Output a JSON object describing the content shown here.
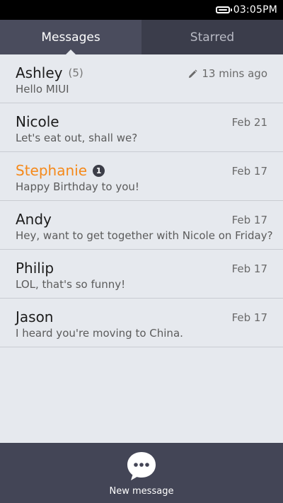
{
  "status_bar": {
    "time": "03:05PM",
    "battery_icon": "battery-full-icon"
  },
  "tabs": [
    {
      "label": "Messages",
      "active": true
    },
    {
      "label": "Starred",
      "active": false
    }
  ],
  "conversations": [
    {
      "name": "Ashley",
      "count": "(5)",
      "time": "13 mins ago",
      "draft_icon": "pencil-icon",
      "preview": "Hello MIUI"
    },
    {
      "name": "Nicole",
      "time": "Feb 21",
      "preview": "Let's eat out, shall we?"
    },
    {
      "name": "Stephanie",
      "unread": "1",
      "time": "Feb 17",
      "preview": "Happy Birthday to you!",
      "highlight_color": "#f5891a"
    },
    {
      "name": "Andy",
      "time": "Feb 17",
      "preview": "Hey, want to get together with Nicole on Friday?"
    },
    {
      "name": "Philip",
      "time": "Feb 17",
      "preview": "LOL, that's so funny!"
    },
    {
      "name": "Jason",
      "time": "Feb 17",
      "preview": "I heard you're moving to China."
    }
  ],
  "bottom_bar": {
    "label": "New message",
    "icon": "speech-bubble-icon"
  },
  "colors": {
    "tab_bar": "#3b3d4b",
    "active_tab": "#4a4c5d",
    "list_background": "#e6e9ee",
    "bottom_bar": "#434556",
    "unread_name": "#f5891a"
  }
}
